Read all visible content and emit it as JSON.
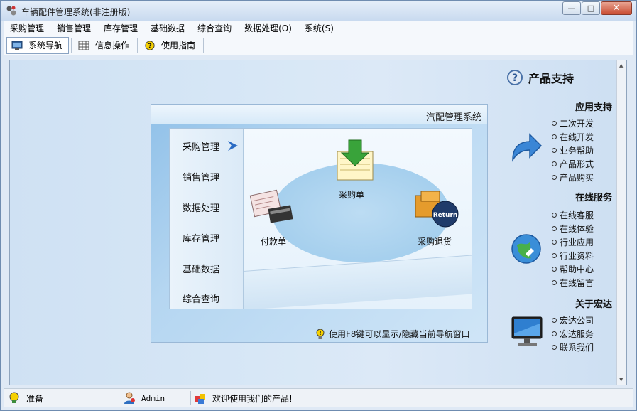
{
  "window": {
    "title": "车辆配件管理系统(非注册版)"
  },
  "menubar": {
    "items": [
      "采购管理",
      "销售管理",
      "库存管理",
      "基础数据",
      "综合查询",
      "数据处理(O)",
      "系统(S)"
    ]
  },
  "toolbar": {
    "items": [
      "系统导航",
      "信息操作",
      "使用指南"
    ]
  },
  "panel": {
    "title": "汽配管理系统",
    "nav": [
      "采购管理",
      "销售管理",
      "数据处理",
      "库存管理",
      "基础数据",
      "综合查询"
    ],
    "functions": {
      "purchase_order": "采购单",
      "payment": "付款单",
      "purchase_return": "采购退货",
      "return_badge": "Return"
    },
    "footer": "使用F8键可以显示/隐藏当前导航窗口"
  },
  "sidebar": {
    "title": "产品支持",
    "app_support": {
      "heading": "应用支持",
      "links": [
        "二次开发",
        "在线开发",
        "业务帮助",
        "产品形式",
        "产品购买"
      ]
    },
    "online_service": {
      "heading": "在线服务",
      "links": [
        "在线客服",
        "在线体验",
        "行业应用",
        "行业资料",
        "帮助中心",
        "在线留言"
      ]
    },
    "about": {
      "heading": "关于宏达",
      "links": [
        "宏达公司",
        "宏达服务",
        "联系我们"
      ]
    }
  },
  "statusbar": {
    "ready": "准备",
    "user": "Admin",
    "welcome": "欢迎使用我们的产品!"
  }
}
